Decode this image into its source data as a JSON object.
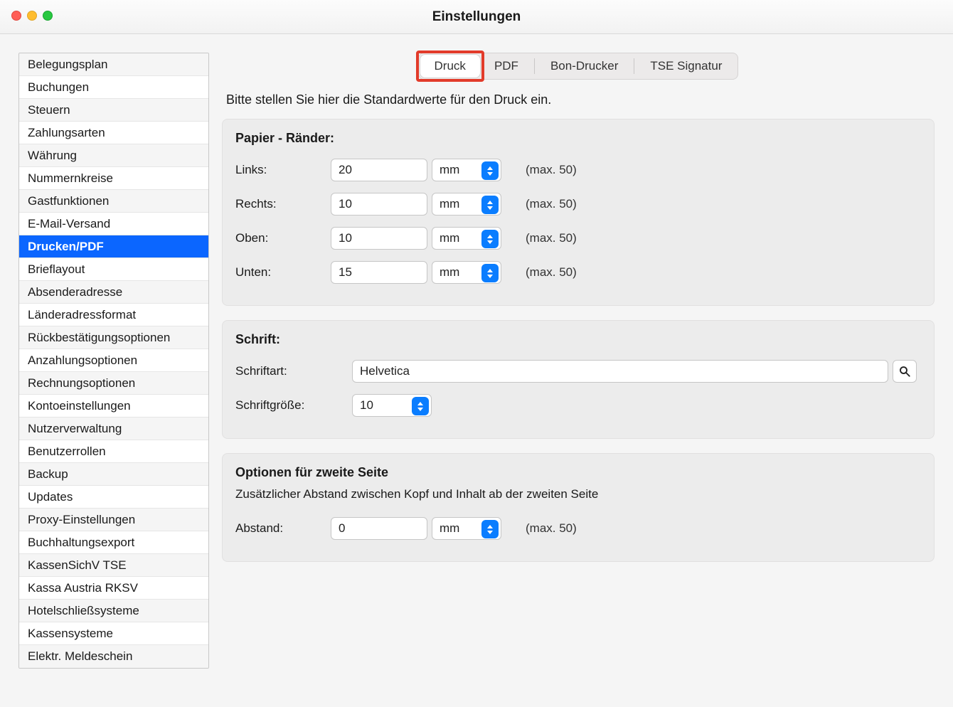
{
  "window": {
    "title": "Einstellungen"
  },
  "sidebar": {
    "items": [
      {
        "label": "Belegungsplan",
        "selected": false
      },
      {
        "label": "Buchungen",
        "selected": false
      },
      {
        "label": "Steuern",
        "selected": false
      },
      {
        "label": "Zahlungsarten",
        "selected": false
      },
      {
        "label": "Währung",
        "selected": false
      },
      {
        "label": "Nummernkreise",
        "selected": false
      },
      {
        "label": "Gastfunktionen",
        "selected": false
      },
      {
        "label": "E-Mail-Versand",
        "selected": false
      },
      {
        "label": "Drucken/PDF",
        "selected": true
      },
      {
        "label": "Brieflayout",
        "selected": false
      },
      {
        "label": "Absenderadresse",
        "selected": false
      },
      {
        "label": "Länderadressformat",
        "selected": false
      },
      {
        "label": "Rückbestätigungsoptionen",
        "selected": false
      },
      {
        "label": "Anzahlungsoptionen",
        "selected": false
      },
      {
        "label": "Rechnungsoptionen",
        "selected": false
      },
      {
        "label": "Kontoeinstellungen",
        "selected": false
      },
      {
        "label": "Nutzerverwaltung",
        "selected": false
      },
      {
        "label": "Benutzerrollen",
        "selected": false
      },
      {
        "label": "Backup",
        "selected": false
      },
      {
        "label": "Updates",
        "selected": false
      },
      {
        "label": "Proxy-Einstellungen",
        "selected": false
      },
      {
        "label": "Buchhaltungsexport",
        "selected": false
      },
      {
        "label": "KassenSichV TSE",
        "selected": false
      },
      {
        "label": "Kassa Austria RKSV",
        "selected": false
      },
      {
        "label": "Hotelschließsysteme",
        "selected": false
      },
      {
        "label": "Kassensysteme",
        "selected": false
      },
      {
        "label": "Elektr. Meldeschein",
        "selected": false
      }
    ]
  },
  "tabs": [
    {
      "label": "Druck",
      "active": true,
      "highlighted": true
    },
    {
      "label": "PDF",
      "active": false
    },
    {
      "label": "Bon-Drucker",
      "active": false
    },
    {
      "label": "TSE Signatur",
      "active": false
    }
  ],
  "intro": "Bitte stellen Sie hier die Standardwerte für den Druck ein.",
  "margins": {
    "title": "Papier - Ränder:",
    "hint": "(max. 50)",
    "unit": "mm",
    "rows": [
      {
        "label": "Links:",
        "value": "20"
      },
      {
        "label": "Rechts:",
        "value": "10"
      },
      {
        "label": "Oben:",
        "value": "10"
      },
      {
        "label": "Unten:",
        "value": "15"
      }
    ]
  },
  "font": {
    "title": "Schrift:",
    "face_label": "Schriftart:",
    "face_value": "Helvetica",
    "size_label": "Schriftgröße:",
    "size_value": "10"
  },
  "page2": {
    "title": "Optionen für zweite Seite",
    "desc": "Zusätzlicher Abstand zwischen Kopf und Inhalt ab der zweiten Seite",
    "distance_label": "Abstand:",
    "distance_value": "0",
    "unit": "mm",
    "hint": "(max. 50)"
  }
}
